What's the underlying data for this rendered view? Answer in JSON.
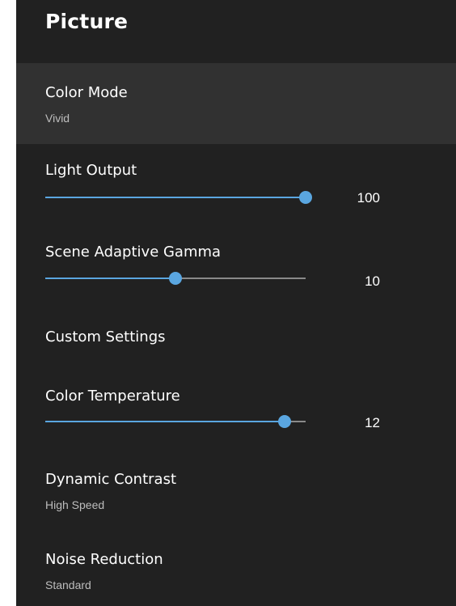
{
  "header": {
    "title": "Picture"
  },
  "items": {
    "color_mode": {
      "label": "Color Mode",
      "value": "Vivid"
    },
    "light_output": {
      "label": "Light Output",
      "value": "100",
      "level": 1.0
    },
    "scene_adaptive_gamma": {
      "label": "Scene Adaptive Gamma",
      "value": "10",
      "level": 0.5
    },
    "custom_settings": {
      "label": "Custom Settings"
    },
    "color_temperature": {
      "label": "Color Temperature",
      "value": "12",
      "level": 0.92
    },
    "dynamic_contrast": {
      "label": "Dynamic Contrast",
      "value": "High Speed"
    },
    "noise_reduction": {
      "label": "Noise Reduction",
      "value": "Standard"
    }
  },
  "colors": {
    "background": "#212121",
    "selected_row": "#313131",
    "accent": "#5aa6e0"
  }
}
